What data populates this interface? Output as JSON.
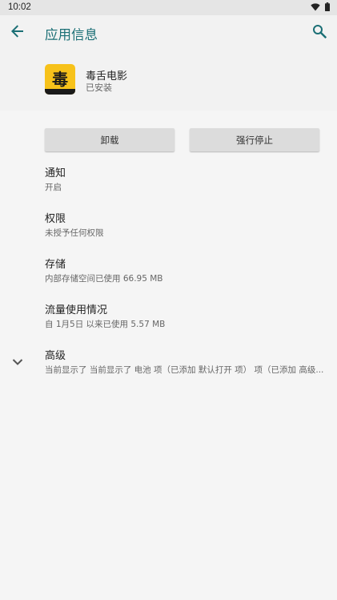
{
  "status_bar": {
    "time": "10:02"
  },
  "app_bar": {
    "title": "应用信息",
    "back_icon": "arrow-back-icon",
    "search_icon": "search-icon",
    "accent_color": "#1b6f75"
  },
  "app": {
    "name": "毒舌电影",
    "status": "已安装",
    "icon_glyph": "毒",
    "icon_color": "#f7c21a"
  },
  "actions": {
    "uninstall_label": "卸载",
    "force_stop_label": "强行停止"
  },
  "settings": [
    {
      "title": "通知",
      "summary": "开启"
    },
    {
      "title": "权限",
      "summary": "未授予任何权限"
    },
    {
      "title": "存储",
      "summary": "内部存储空间已使用 66.95 MB"
    },
    {
      "title": "流量使用情况",
      "summary": "自 1月5日 以来已使用 5.57 MB"
    },
    {
      "title": "高级",
      "summary": "当前显示了 当前显示了 电池 项（已添加 默认打开 项） 项（已添加 高级..."
    }
  ]
}
